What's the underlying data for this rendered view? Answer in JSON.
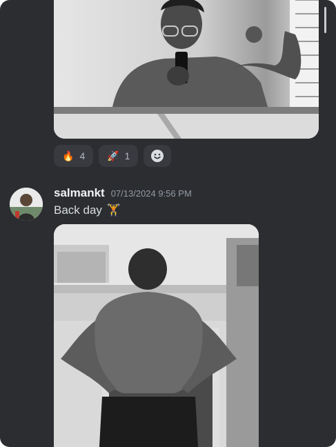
{
  "reactions": [
    {
      "emoji": "🔥",
      "icon": "fire-icon",
      "count": "4"
    },
    {
      "emoji": "🚀",
      "icon": "rocket-icon",
      "count": "1"
    }
  ],
  "add_reaction_icon": "smiley-icon",
  "message": {
    "username": "salmankt",
    "timestamp": "07/13/2024 9:56 PM",
    "text": "Back day",
    "text_emoji": "🏋️",
    "text_emoji_icon": "weightlifter-icon"
  },
  "colors": {
    "background": "#2b2d31",
    "reaction_bg": "#383a40",
    "username": "#f2f3f5",
    "timestamp": "#949ba4"
  }
}
